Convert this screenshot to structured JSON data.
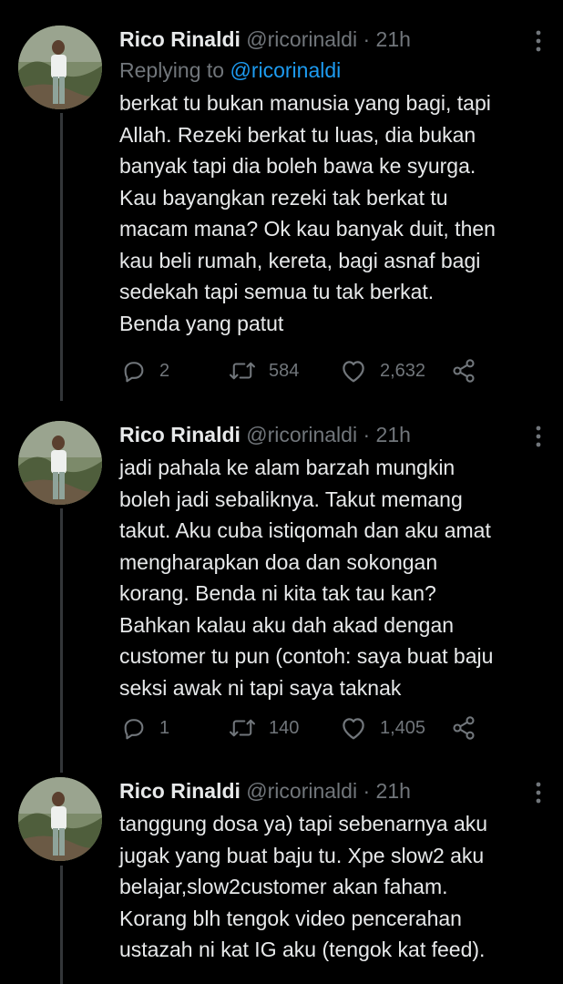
{
  "thread": {
    "tweets": [
      {
        "author": "Rico Rinaldi",
        "handle": "@ricorinaldi",
        "separator": "·",
        "time": "21h",
        "replying_prefix": "Replying to ",
        "replying_to": "@ricorinaldi",
        "lines": [
          "berkat tu bukan manusia yang bagi, tapi",
          "Allah. Rezeki berkat tu luas, dia bukan",
          "banyak tapi dia boleh bawa ke syurga.",
          "Kau bayangkan rezeki tak berkat tu",
          "macam mana? Ok kau banyak duit, then",
          "kau beli rumah, kereta, bagi asnaf bagi",
          "sedekah tapi semua tu tak berkat.",
          "Benda yang patut"
        ],
        "replies": "2",
        "retweets": "584",
        "likes": "2,632"
      },
      {
        "author": "Rico Rinaldi",
        "handle": "@ricorinaldi",
        "separator": "·",
        "time": "21h",
        "lines": [
          "jadi pahala ke alam barzah mungkin",
          "boleh jadi sebaliknya. Takut memang",
          "takut. Aku cuba istiqomah dan aku amat",
          "mengharapkan doa dan sokongan",
          "korang. Benda ni kita tak tau kan?",
          "Bahkan kalau aku dah akad dengan",
          "customer tu pun (contoh: saya buat baju",
          "seksi awak ni tapi saya taknak"
        ],
        "replies": "1",
        "retweets": "140",
        "likes": "1,405"
      },
      {
        "author": "Rico Rinaldi",
        "handle": "@ricorinaldi",
        "separator": "·",
        "time": "21h",
        "lines": [
          "tanggung dosa ya) tapi sebenarnya aku",
          "jugak yang buat baju tu. Xpe slow2 aku",
          "belajar,slow2customer akan faham.",
          "Korang blh tengok video pencerahan",
          "ustazah ni kat IG aku (tengok kat feed)."
        ]
      }
    ]
  },
  "icons": {
    "more": "more-vertical-icon",
    "reply": "reply-icon",
    "retweet": "retweet-icon",
    "like": "heart-icon",
    "share": "share-icon"
  },
  "colors": {
    "background": "#000000",
    "text": "#e7e9ea",
    "muted": "#71767b",
    "link": "#1d9bf0",
    "thread_line": "#333639"
  }
}
